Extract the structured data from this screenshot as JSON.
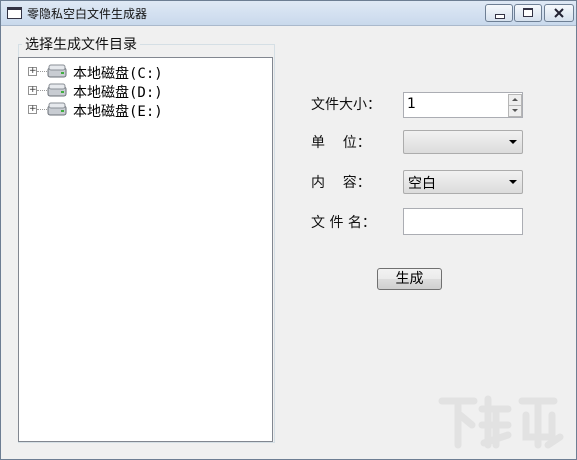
{
  "window": {
    "title": "零隐私空白文件生成器"
  },
  "group": {
    "title": "选择生成文件目录"
  },
  "tree": {
    "items": [
      {
        "label": "本地磁盘(C:)"
      },
      {
        "label": "本地磁盘(D:)"
      },
      {
        "label": "本地磁盘(E:)"
      }
    ]
  },
  "form": {
    "size_label": "文件大小：",
    "size_value": "1",
    "unit_label": "单    位：",
    "unit_value": "",
    "content_label": "内    容：",
    "content_value": "空白",
    "filename_label": "文 件 名：",
    "filename_value": "",
    "generate_label": "生成"
  },
  "watermark": {
    "text": "下载吧"
  }
}
